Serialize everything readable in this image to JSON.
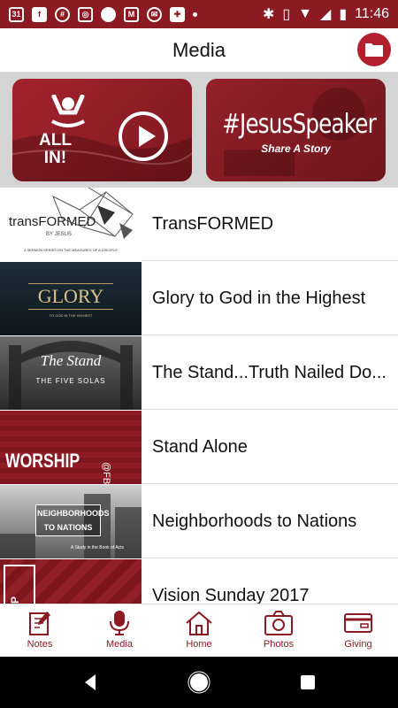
{
  "status_bar": {
    "date_badge": "31",
    "time": "11:46",
    "bg_color": "#8b1a23"
  },
  "app_bar": {
    "title": "Media",
    "action_icon": "folder-icon"
  },
  "banners": [
    {
      "id": "all-in",
      "text": "ALL\nIN!",
      "icon": "play-icon"
    },
    {
      "id": "jesus-speaker",
      "hashtag": "#JesusSpeaker",
      "subtitle": "Share A Story"
    }
  ],
  "media_list": [
    {
      "title": "TransFORMED",
      "thumb_text": "transFORMED",
      "thumb_sub": "BY JESUS",
      "thumb_caption": "A SERMON SERIES ON THE MEASURES OF A DISCIPLE"
    },
    {
      "title": "Glory to God in the Highest",
      "thumb_text": "GLORY",
      "thumb_sub": "TO GOD IN THE HIGHEST"
    },
    {
      "title": "The Stand...Truth Nailed Do...",
      "thumb_text": "The Stand",
      "thumb_sub": "THE FIVE SOLAS"
    },
    {
      "title": "Stand Alone",
      "thumb_text": "WORSHIP",
      "thumb_sub": "@FBK"
    },
    {
      "title": "Neighborhoods to Nations",
      "thumb_text": "NEIGHBORHOODS\nTO NATIONS",
      "thumb_sub": "A Study in the Book of Acts"
    },
    {
      "title": "Vision Sunday 2017",
      "thumb_text": "SHIP"
    }
  ],
  "bottom_nav": [
    {
      "label": "Notes",
      "icon": "notes-icon"
    },
    {
      "label": "Media",
      "icon": "microphone-icon"
    },
    {
      "label": "Home",
      "icon": "home-icon"
    },
    {
      "label": "Photos",
      "icon": "camera-icon"
    },
    {
      "label": "Giving",
      "icon": "credit-card-icon"
    }
  ],
  "colors": {
    "brand": "#8b1a23",
    "accent": "#b1202c"
  }
}
